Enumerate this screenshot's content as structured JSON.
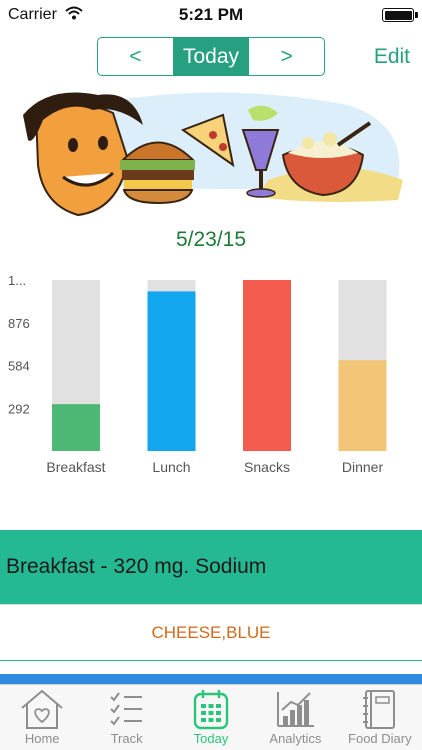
{
  "status_bar": {
    "carrier": "Carrier",
    "time": "5:21 PM",
    "wifi_icon": "wifi-icon",
    "battery_icon": "battery-icon"
  },
  "nav": {
    "prev_label": "<",
    "current_label": "Today",
    "next_label": ">",
    "edit_label": "Edit",
    "accent_color": "#27a082"
  },
  "illustration": {
    "subject": "cartoon-face-with-food"
  },
  "date": "5/23/15",
  "chart_data": {
    "type": "bar",
    "categories": [
      "Breakfast",
      "Lunch",
      "Snacks",
      "Dinner"
    ],
    "values": [
      320,
      1090,
      1370,
      620
    ],
    "max": 1168,
    "ytick_labels": [
      "1...",
      "876",
      "584",
      "292"
    ],
    "ytick_values": [
      1168,
      876,
      584,
      292
    ],
    "colors": [
      "#4db873",
      "#11a6ee",
      "#f45b4f",
      "#f3c677"
    ],
    "track_color": "#e1e1e1",
    "grid": false,
    "legend": "none"
  },
  "meal": {
    "header": "Breakfast - 320 mg. Sodium",
    "items": [
      "CHEESE,BLUE"
    ]
  },
  "tabs": [
    {
      "label": "Home",
      "icon": "home-icon",
      "active": false
    },
    {
      "label": "Track",
      "icon": "checklist-icon",
      "active": false
    },
    {
      "label": "Today",
      "icon": "calendar-icon",
      "active": true
    },
    {
      "label": "Analytics",
      "icon": "analytics-chart-icon",
      "active": false
    },
    {
      "label": "Food Diary",
      "icon": "notebook-icon",
      "active": false
    }
  ]
}
